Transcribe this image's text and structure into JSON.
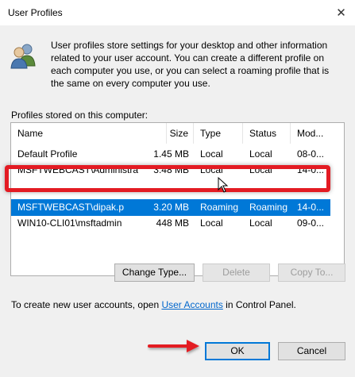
{
  "window": {
    "title": "User Profiles",
    "close_glyph": "✕"
  },
  "description": "User profiles store settings for your desktop and other information related to your user account. You can create a different profile on each computer you use, or you can select a roaming profile that is the same on every computer you use.",
  "profiles_label": "Profiles stored on this computer:",
  "list": {
    "columns": [
      {
        "label": "Name"
      },
      {
        "label": "Size"
      },
      {
        "label": "Type"
      },
      {
        "label": "Status"
      },
      {
        "label": "Mod..."
      }
    ],
    "rows": [
      {
        "name": "Default Profile",
        "size": "1.45 MB",
        "type": "Local",
        "status": "Local",
        "modified": "08-0..."
      },
      {
        "name": "MSFTWEBCAST\\Administrat...",
        "size": "3.48 MB",
        "type": "Local",
        "status": "Local",
        "modified": "14-0..."
      },
      {
        "name": "MSFTWEBCAST\\dipak.p",
        "size": "3.20 MB",
        "type": "Roaming",
        "status": "Roaming",
        "modified": "14-0...",
        "selected": true
      },
      {
        "name": "WIN10-CLI01\\msftadmin",
        "size": "448 MB",
        "type": "Local",
        "status": "Local",
        "modified": "09-0..."
      }
    ]
  },
  "buttons": {
    "change_type": "Change Type...",
    "delete": "Delete",
    "copy_to": "Copy To...",
    "ok": "OK",
    "cancel": "Cancel"
  },
  "footer": {
    "prefix": "To create new user accounts, open ",
    "link": "User Accounts",
    "suffix": " in Control Panel."
  },
  "colors": {
    "selection": "#0078d7",
    "annotation_red": "#e31b23",
    "link": "#0066cc"
  },
  "icons": [
    "users-icon",
    "close-icon",
    "mouse-cursor-icon",
    "annotation-arrow-icon"
  ]
}
